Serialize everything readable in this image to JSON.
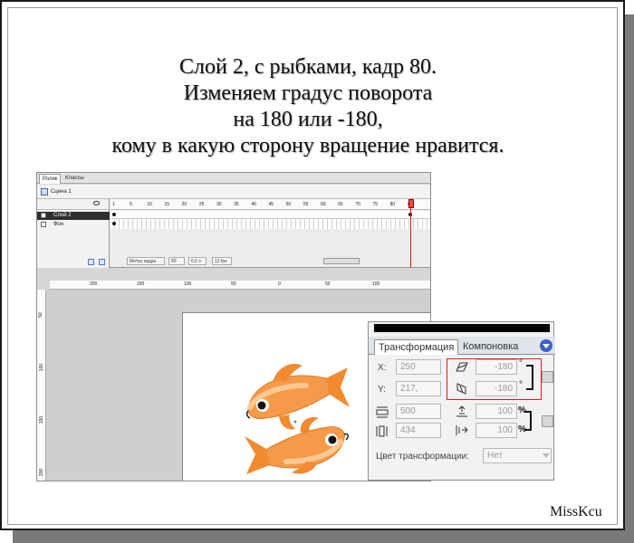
{
  "caption": {
    "line1": "Слой 2, с рыбками, кадр 80.",
    "line2": "Изменяем градус поворота",
    "line3": "на 180 или -180,",
    "line4": "кому в какую сторону вращение нравится."
  },
  "signature": "MissKcu",
  "flash": {
    "tabs": [
      "Ролик",
      "Классы"
    ],
    "scene_label": "Сцена 1",
    "layers": [
      {
        "name": "Слой 2",
        "selected": true
      },
      {
        "name": "Фон",
        "selected": false
      }
    ],
    "frame_ruler": [
      "1",
      "5",
      "10",
      "15",
      "20",
      "25",
      "30",
      "35",
      "40",
      "45",
      "50",
      "55",
      "60",
      "65",
      "70",
      "75",
      "80",
      "85"
    ],
    "status": {
      "label_field": "Метка кадра",
      "frame": "80",
      "time": "6,6 s",
      "fps": "12 fps"
    },
    "stage_ruler_h": [
      "200",
      "150",
      "100",
      "50",
      "0",
      "50",
      "100"
    ],
    "stage_ruler_v": [
      "50",
      "100",
      "150",
      "200"
    ]
  },
  "transform_panel": {
    "tabs": {
      "active": "Трансформация",
      "inactive": "Компоновка"
    },
    "x_label": "X:",
    "x_value": "250",
    "y_label": "Y:",
    "y_value": "217,",
    "skew_h": "-180",
    "skew_v": "-180",
    "degree_symbol": "°",
    "width": "500",
    "height": "434",
    "scale_w": "100",
    "scale_h": "100",
    "percent": "%",
    "color_label": "Цвет трансформации:",
    "color_value": "Нет"
  }
}
